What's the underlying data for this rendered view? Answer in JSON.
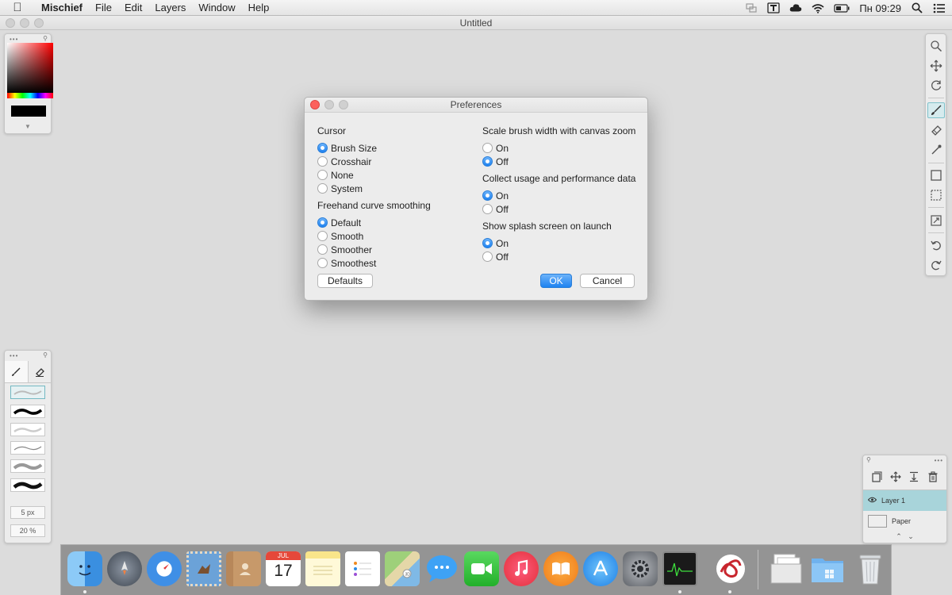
{
  "menubar": {
    "apple_icon": "apple-logo-icon",
    "app_name": "Mischief",
    "menus": [
      "File",
      "Edit",
      "Layers",
      "Window",
      "Help"
    ],
    "clock": "Пн 09:29",
    "status_icons": [
      "screen-share-icon",
      "input-source-icon",
      "cloud-icon",
      "wifi-icon",
      "battery-icon",
      "spotlight-icon",
      "notification-center-icon"
    ]
  },
  "window": {
    "title": "Untitled"
  },
  "color_panel": {
    "current_color": "#000000"
  },
  "brush_panel": {
    "tabs": [
      "brush-tool-icon",
      "eraser-tool-icon"
    ],
    "size_value": "5 px",
    "opacity_value": "20 %"
  },
  "tool_panel": {
    "tools": [
      "zoom-icon",
      "pan-icon",
      "rotate-icon",
      "brush-icon",
      "eraser-icon",
      "eyedropper-icon",
      "rectangle-select-icon",
      "lasso-select-icon",
      "transform-icon",
      "undo-icon",
      "redo-icon"
    ]
  },
  "layer_panel": {
    "layers": [
      {
        "name": "Layer 1",
        "selected": true
      },
      {
        "name": "Paper",
        "selected": false
      }
    ]
  },
  "dialog": {
    "title": "Preferences",
    "cursor": {
      "heading": "Cursor",
      "options": [
        "Brush Size",
        "Crosshair",
        "None",
        "System"
      ],
      "selected": "Brush Size"
    },
    "smoothing": {
      "heading": "Freehand curve smoothing",
      "options": [
        "Default",
        "Smooth",
        "Smoother",
        "Smoothest"
      ],
      "selected": "Default"
    },
    "scale_brush": {
      "heading": "Scale brush width with canvas zoom",
      "options": [
        "On",
        "Off"
      ],
      "selected": "Off"
    },
    "usage_data": {
      "heading": "Collect usage and performance data",
      "options": [
        "On",
        "Off"
      ],
      "selected": "On"
    },
    "splash": {
      "heading": "Show splash screen on launch",
      "options": [
        "On",
        "Off"
      ],
      "selected": "On"
    },
    "defaults_label": "Defaults",
    "ok_label": "OK",
    "cancel_label": "Cancel"
  },
  "dock": {
    "apps": [
      "Finder",
      "Launchpad",
      "Safari",
      "Mail",
      "Contacts",
      "Calendar",
      "Notes",
      "Reminders",
      "Maps",
      "Messages",
      "FaceTime",
      "iTunes",
      "iBooks",
      "App Store",
      "System Preferences",
      "Activity Monitor",
      "Mischief"
    ],
    "calendar_month": "JUL",
    "calendar_day": "17",
    "stacks": [
      "Documents",
      "Downloads",
      "Trash"
    ]
  }
}
